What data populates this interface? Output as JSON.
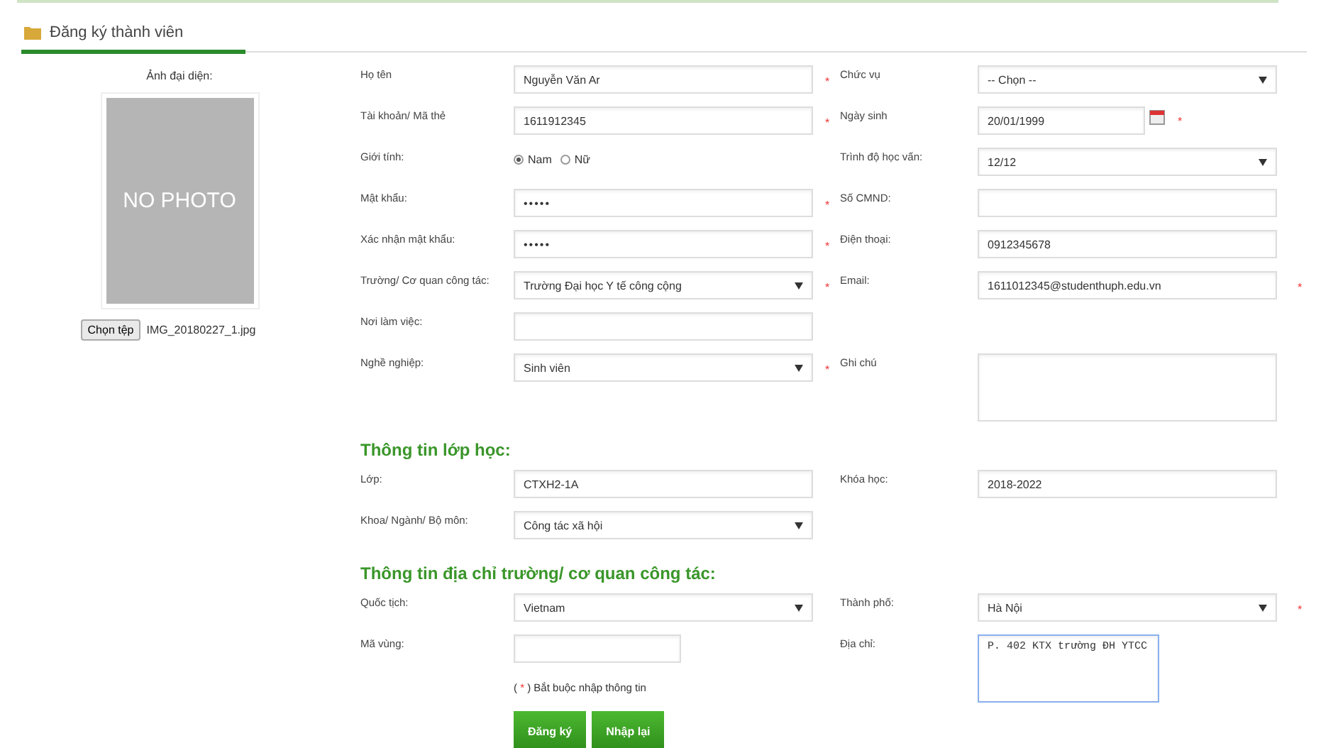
{
  "title": "Đăng ký thành viên",
  "required_mark": "*",
  "avatar": {
    "label": "Ảnh đại diện:",
    "placeholder_text": "NO PHOTO",
    "file_button": "Chọn tệp",
    "file_name": "IMG_20180227_1.jpg"
  },
  "sections": [
    {
      "rows": [
        {
          "left": {
            "label": "Họ tên",
            "kind": "text",
            "value": "Nguyễn Văn Ar",
            "required": true
          },
          "right": {
            "label": "Chức vụ",
            "kind": "select",
            "value": "-- Chọn --",
            "required": false
          }
        },
        {
          "left": {
            "label": "Tài khoản/ Mã thẻ",
            "kind": "text",
            "value": "1611912345",
            "required": true
          },
          "right": {
            "label": "Ngày sinh",
            "kind": "date",
            "value": "20/01/1999",
            "required": true
          }
        },
        {
          "left": {
            "label": "Giới tính:",
            "kind": "radio",
            "options": [
              {
                "label": "Nam",
                "selected": true
              },
              {
                "label": "Nữ",
                "selected": false
              }
            ],
            "required": false
          },
          "right": {
            "label": "Trình độ học vấn:",
            "kind": "select",
            "value": "12/12",
            "required": false
          }
        },
        {
          "left": {
            "label": "Mật khẩu:",
            "kind": "password",
            "value": "•••••",
            "required": true
          },
          "right": {
            "label": "Số CMND:",
            "kind": "text",
            "required": false
          }
        },
        {
          "left": {
            "label": "Xác nhận mật khẩu:",
            "kind": "password",
            "value": "•••••",
            "required": true
          },
          "right": {
            "label": "Điện thoại:",
            "kind": "text",
            "value": "0912345678",
            "required": false
          }
        },
        {
          "left": {
            "label": "Trường/ Cơ quan công tác:",
            "kind": "select",
            "value": "Trường Đại học Y tế công cộng",
            "required": true
          },
          "right": {
            "label": "Email:",
            "kind": "text",
            "value": "1611012345@studenthuph.edu.vn",
            "required": true
          }
        },
        {
          "left": {
            "label": "Nơi làm việc:",
            "kind": "text",
            "required": false
          }
        },
        {
          "left": {
            "label": "Nghề nghiệp:",
            "kind": "select",
            "value": "Sinh viên",
            "required": true
          },
          "right": {
            "label": "Ghi chú",
            "kind": "textarea",
            "required": false
          }
        }
      ]
    },
    {
      "heading": "Thông tin lớp học:",
      "rows": [
        {
          "left": {
            "label": "Lớp:",
            "kind": "text",
            "value": "CTXH2-1A",
            "required": false
          },
          "right": {
            "label": "Khóa học:",
            "kind": "text",
            "value": "2018-2022",
            "required": false
          }
        },
        {
          "left": {
            "label": "Khoa/ Ngành/ Bộ môn:",
            "kind": "select",
            "value": "Công tác xã hội",
            "required": false
          }
        }
      ]
    },
    {
      "heading": "Thông tin địa chỉ trường/ cơ quan công tác:",
      "rows": [
        {
          "left": {
            "label": "Quốc tịch:",
            "kind": "select",
            "value": "Vietnam",
            "required": false
          },
          "right": {
            "label": "Thành phố:",
            "kind": "select",
            "value": "Hà Nội",
            "required": true
          }
        },
        {
          "left": {
            "label": "Mã vùng:",
            "kind": "short",
            "required": false
          },
          "right": {
            "label": "Địa chỉ:",
            "kind": "textarea",
            "value": "P. 402 KTX trường ĐH YTCC",
            "focused": true,
            "required": false
          }
        }
      ]
    }
  ],
  "note": {
    "open": "(",
    "close": ") Bắt buộc nhập thông tin"
  },
  "buttons": [
    "Đăng ký",
    "Nhập lại"
  ]
}
